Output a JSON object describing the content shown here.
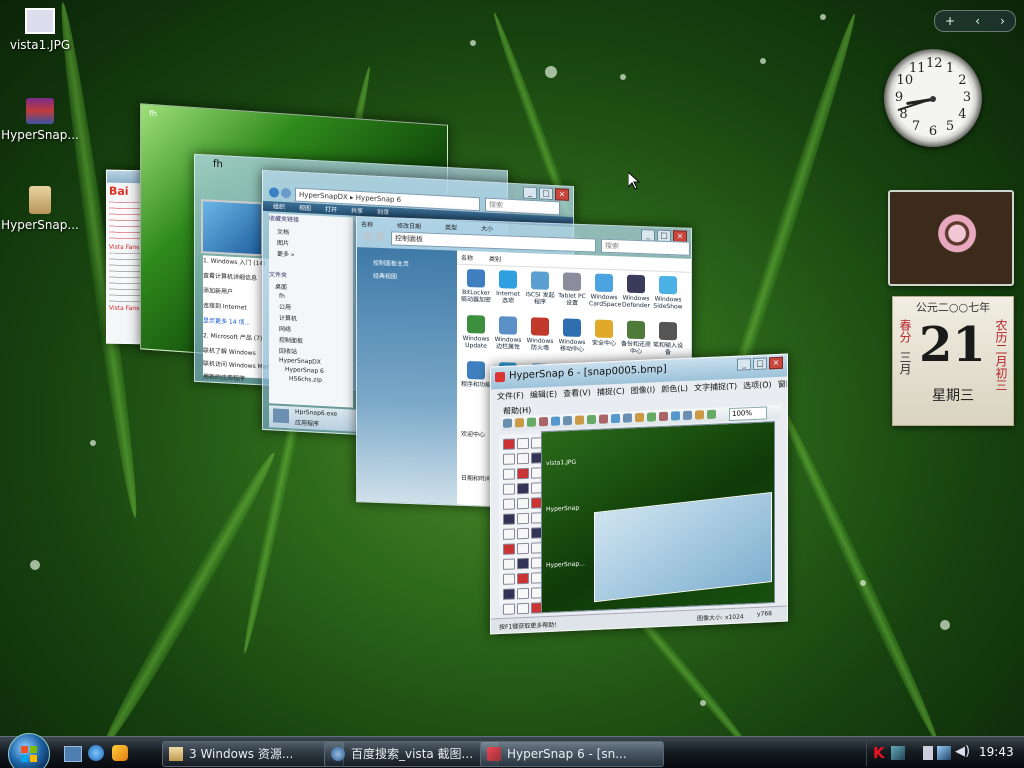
{
  "desktop": {
    "icons": [
      {
        "label": "vista1.JPG"
      },
      {
        "label": "HyperSnap..."
      },
      {
        "label": "HyperSnap..."
      }
    ]
  },
  "windows": {
    "baidu": {
      "lines": [
        "Bai",
        "Vista Fans",
        "Vista Fans E"
      ]
    },
    "green_left": {
      "title": "fh"
    },
    "explorer1": {
      "side_items": [
        "收藏夹链接",
        "文档",
        "图片",
        "更多 »",
        "文件夹",
        "桌面",
        "fh",
        "公用",
        "计算机",
        "网络",
        "控制面板",
        "回收站",
        "HyperSnapDX",
        "HyperSnap 6",
        "HS6chs.zip"
      ],
      "welcome_items": [
        "1. Windows 入门 (14)",
        "查看计算机详细信息",
        "添加新用户",
        "连接到 Internet",
        "显示更多 14 项...",
        "2. Microsoft 产品 (7)",
        "联机了解 Windows",
        "联机访问 Windows Marketplace",
        "用新的应用程序"
      ],
      "footer": {
        "title": "HprSnap6.exe",
        "sub": "应用程序"
      }
    },
    "explorer2": {
      "address": "HyperSnapDX ▸ HyperSnap 6",
      "toolbar": [
        "组织",
        "视图",
        "打开",
        "共享",
        "刻录"
      ],
      "search": "搜索"
    },
    "control_panel": {
      "address": "控制面板",
      "search": "搜索",
      "column_headers": [
        "名称",
        "类别"
      ],
      "top_headers": [
        "名称",
        "修改日期",
        "类型",
        "大小"
      ],
      "side_links": [
        "控制面板主页",
        "经典视图"
      ],
      "items": [
        "BitLocker 驱动器加密",
        "Internet 选项",
        "iSCSI 发起程序",
        "Tablet PC 设置",
        "Windows CardSpace",
        "Windows Defender",
        "Windows SideShow",
        "Windows Update",
        "Windows 边栏属性",
        "Windows 防火墙",
        "Windows 移动中心",
        "安全中心",
        "备份和还原中心",
        "笔和输入设备",
        "程序和功能",
        "",
        "",
        "",
        "",
        "",
        ""
      ],
      "left_extra": [
        "欢迎中心",
        "日期和时间"
      ]
    },
    "hypersnap": {
      "title": "HyperSnap 6 - [snap0005.bmp]",
      "menu": [
        "文件(F)",
        "编辑(E)",
        "查看(V)",
        "捕捉(C)",
        "图像(I)",
        "颜色(L)",
        "文字捕捉(T)",
        "选项(O)",
        "窗口(W)"
      ],
      "help_menu": "帮助(H)",
      "zoom": "100%",
      "canvas_icons": [
        "vista1.JPG",
        "HyperSnap",
        "HyperSnap..."
      ],
      "status_left": "按F1键获取更多帮助!",
      "status_size": "图像大小: x1024",
      "status_y": "y768"
    }
  },
  "gadgets": {
    "clock": {
      "numbers": [
        "12",
        "1",
        "2",
        "3",
        "4",
        "5",
        "6",
        "7",
        "8",
        "9",
        "10",
        "11"
      ],
      "hour": 8,
      "minute": 42
    },
    "calendar": {
      "header": "公元二○○七年",
      "day": "21",
      "left_top": "春分",
      "left_bottom": "三月",
      "right_top": "农历二月初三",
      "weekday": "星期三"
    }
  },
  "sidebar_controls": {
    "add": "+",
    "prev": "‹",
    "next": "›"
  },
  "taskbar": {
    "buttons": [
      {
        "label": "3 Windows 资源...",
        "icon": "folder-icon"
      },
      {
        "label": "百度搜索_vista 截图...",
        "icon": "ie-icon"
      },
      {
        "label": "HyperSnap 6 - [sn...",
        "icon": "hypersnap-icon"
      }
    ],
    "time": "19:43"
  },
  "colors": {
    "accent": "#4e8d2a",
    "taskbar": "#0e1318",
    "titlebar": "#9cc3da"
  }
}
